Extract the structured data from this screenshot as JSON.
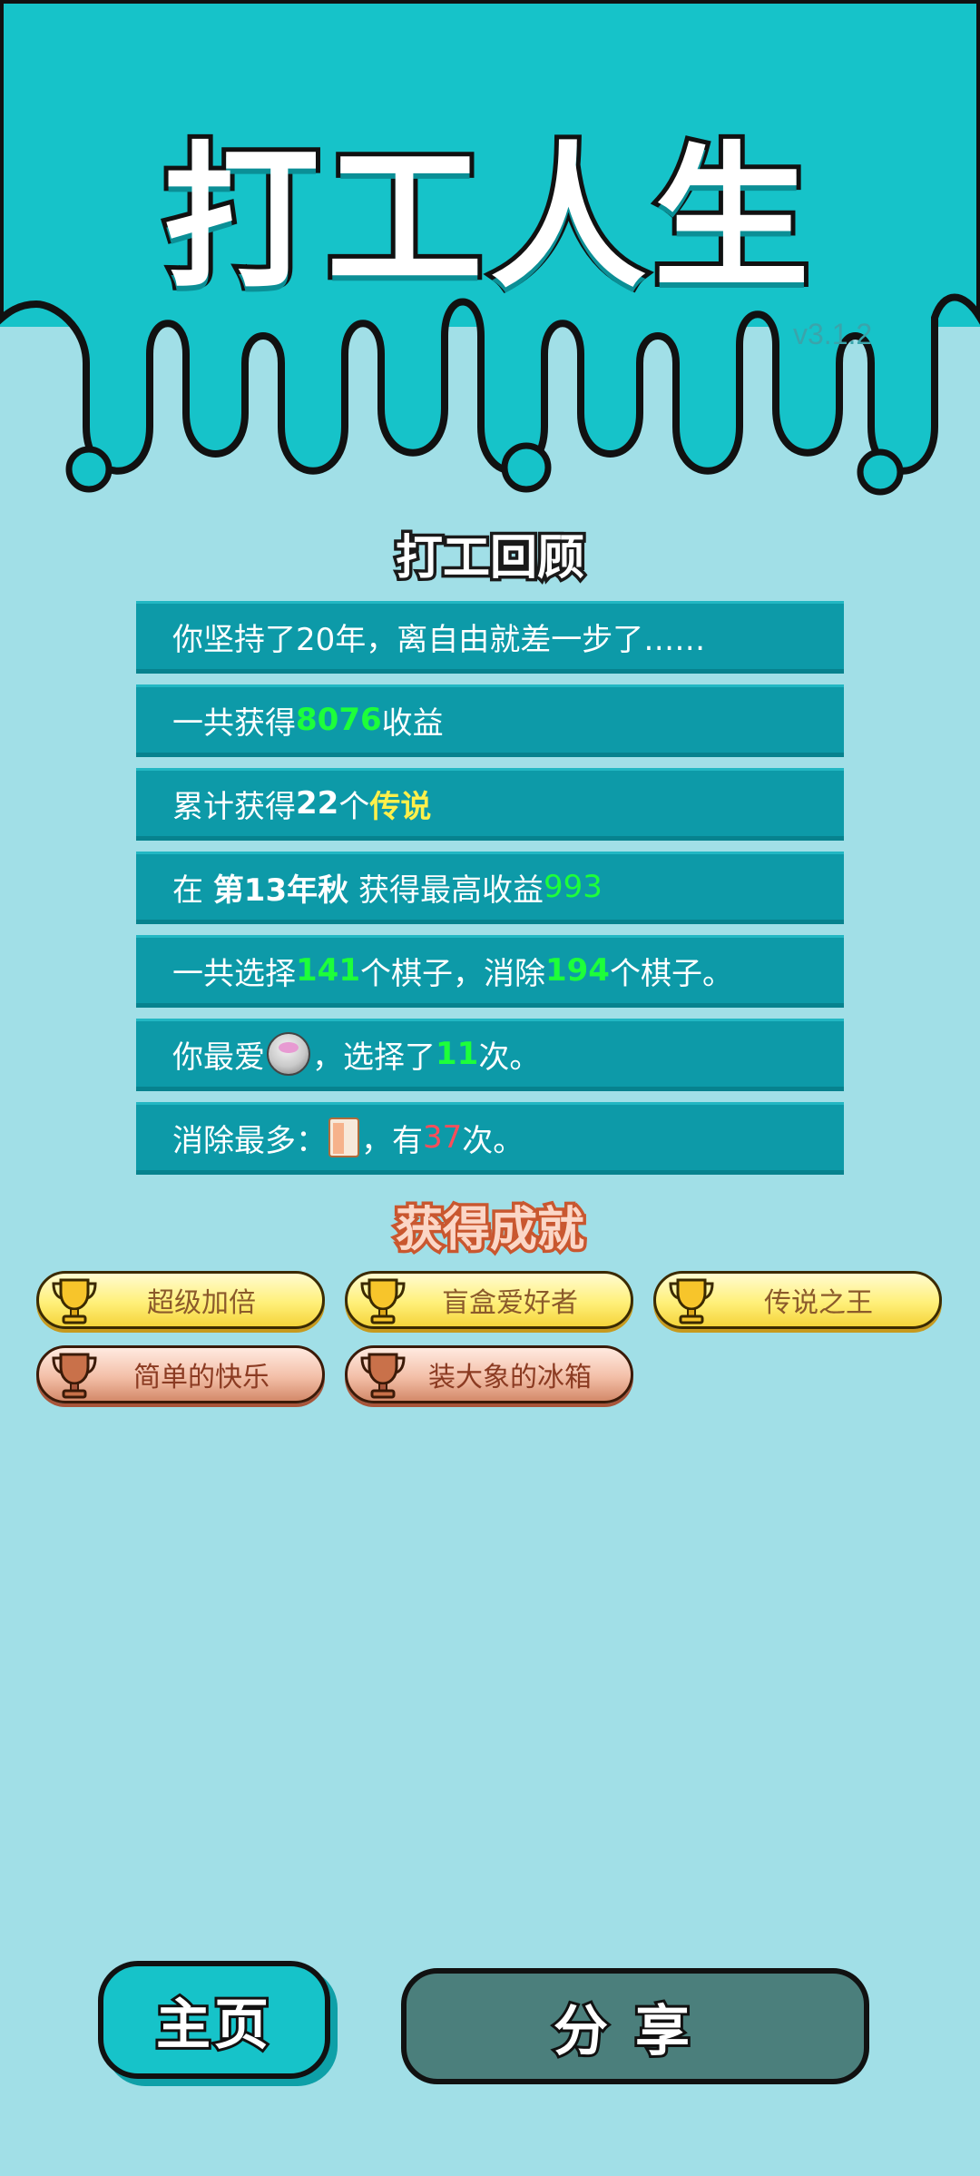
{
  "app": {
    "title": "打工人生",
    "version": "v3.1.2"
  },
  "review": {
    "title": "打工回顾",
    "rows": [
      {
        "a": "你坚持了20年，离自由就差一步了……"
      },
      {
        "a": "一共获得",
        "b": "8076",
        "c": "收益"
      },
      {
        "a": "累计获得",
        "b": "22",
        "c": "个",
        "d": "传说"
      },
      {
        "a": "在 ",
        "b": "第13年秋",
        "c": " 获得最高收益",
        "d": "993"
      },
      {
        "a": "一共选择",
        "b": "141",
        "c": "个棋子，消除",
        "d": "194",
        "e": "个棋子。"
      },
      {
        "a": "你最爱",
        "icon": "rice-cooker-egg-icon",
        "b": "，选择了",
        "c": "11",
        "d": "次。"
      },
      {
        "a": "消除最多：",
        "icon": "fridge-icon",
        "b": "，有",
        "c": "37",
        "d": "次。"
      }
    ]
  },
  "achievements": {
    "title": "获得成就",
    "items": [
      {
        "label": "超级加倍",
        "tier": "gold"
      },
      {
        "label": "盲盒爱好者",
        "tier": "gold"
      },
      {
        "label": "传说之王",
        "tier": "gold"
      },
      {
        "label": "简单的快乐",
        "tier": "bronze"
      },
      {
        "label": "装大象的冰箱",
        "tier": "bronze"
      }
    ]
  },
  "buttons": {
    "home": "主页",
    "share": "分享"
  },
  "colors": {
    "background": "#a1dfe7",
    "teal": "#16c3c9",
    "row": "#0d9aa8",
    "green_value": "#1dff3a",
    "legend": "#fff04a",
    "red_value": "#ff4d5a"
  }
}
